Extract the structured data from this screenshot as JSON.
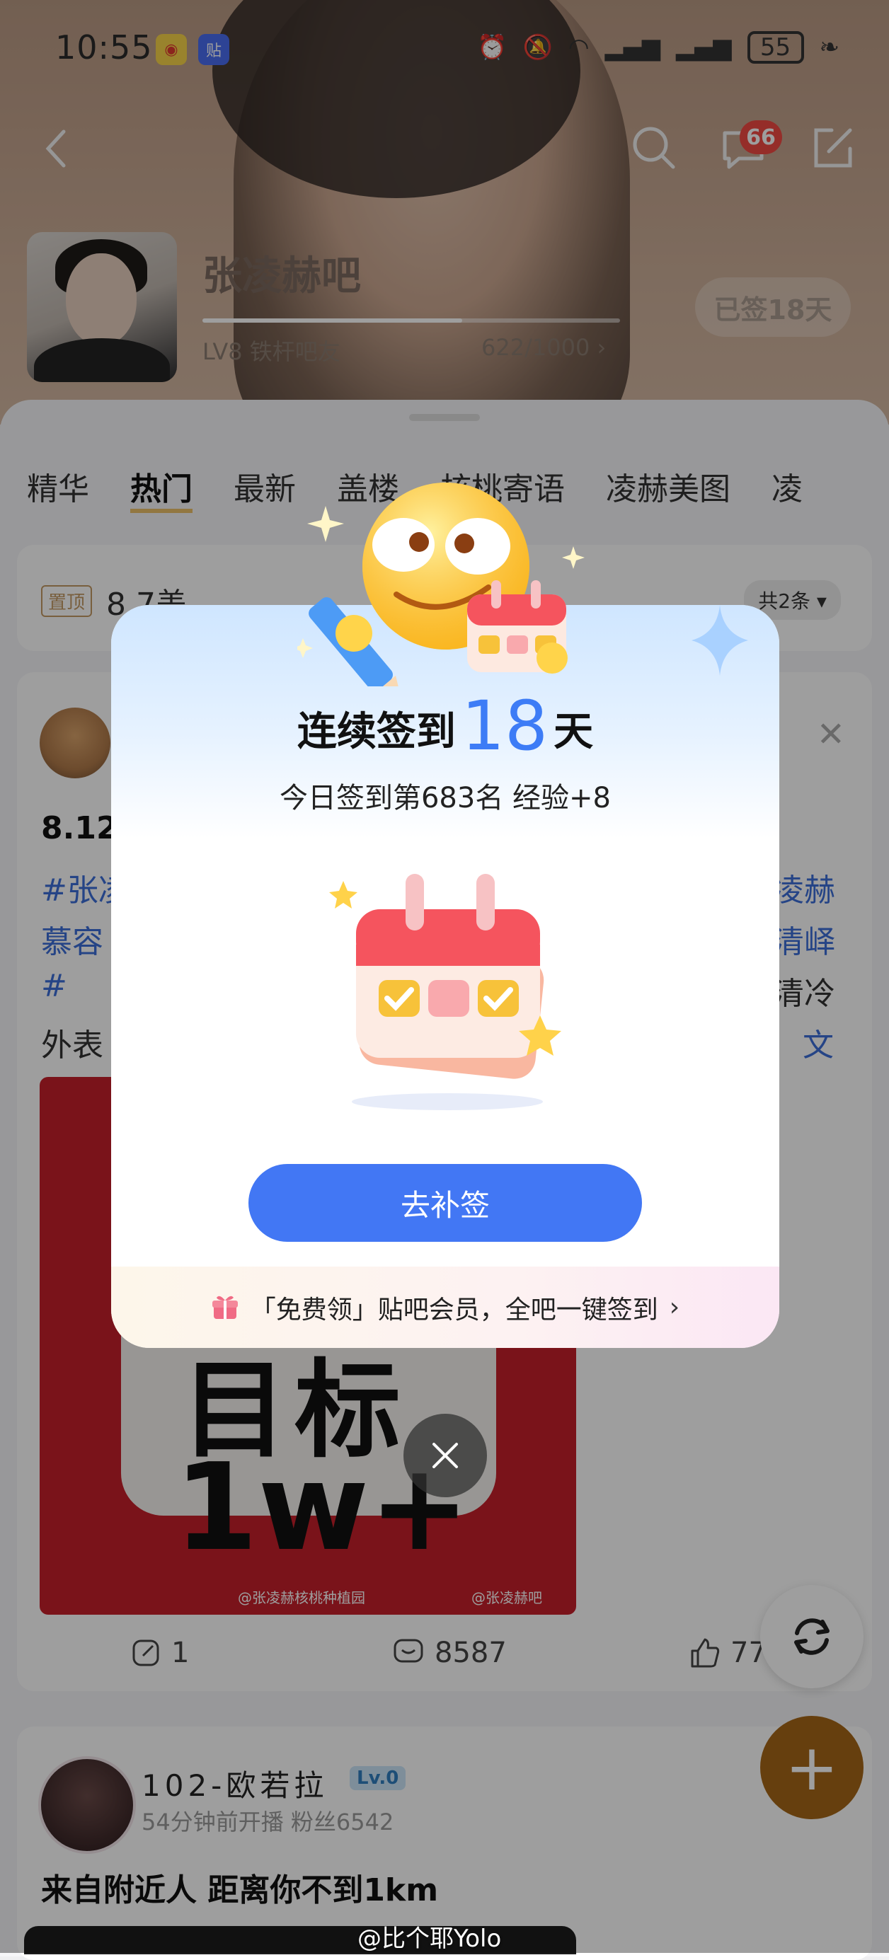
{
  "status_bar": {
    "time": "10:55",
    "battery": "55"
  },
  "header": {
    "message_badge": "66",
    "forum_name": "张凌赫吧",
    "level_label": "LV8 铁杆吧友",
    "exp": "622/1000 ›",
    "exp_fraction": 0.622,
    "signed_label": "已签18天"
  },
  "tabs": [
    "精华",
    "热门",
    "最新",
    "盖楼",
    "核桃寄语",
    "凌赫美图",
    "凌"
  ],
  "active_tab": "热门",
  "pinned": {
    "tag": "置顶",
    "text": "8.7盖",
    "count": "共2条 ▾"
  },
  "post": {
    "title": "8.12",
    "lines": [
      "#张凌",
      "慕容",
      "#",
      "外表"
    ],
    "right_fragments": [
      "凌赫",
      "清峄",
      "清冷",
      "文"
    ],
    "image_text_1": "目标",
    "image_text_2": "1w+",
    "image_credit_left": "@张凌赫核桃种植园",
    "image_credit_right": "@张凌赫吧",
    "share_count": "1",
    "comment_count": "8587",
    "like_count": "77"
  },
  "live_card": {
    "name": "102-欧若拉",
    "level": "Lv.0",
    "meta": "54分钟前开播  粉丝6542",
    "line": "来自附近人  距离你不到1km"
  },
  "watermark": "@比个耶Yolo",
  "modal": {
    "headline_prefix": "连续签到",
    "streak_days": "18",
    "headline_suffix": "天",
    "subline": "今日签到第683名 经验+8",
    "makeup_button": "去补签",
    "promo_text": "「免费领」贴吧会员，全吧一键签到",
    "promo_chevron": "›"
  },
  "colors": {
    "accent_blue": "#4277f4",
    "streak_blue": "#3d7cf6",
    "badge_red": "#f04a43",
    "fab_brown": "#a56618"
  }
}
